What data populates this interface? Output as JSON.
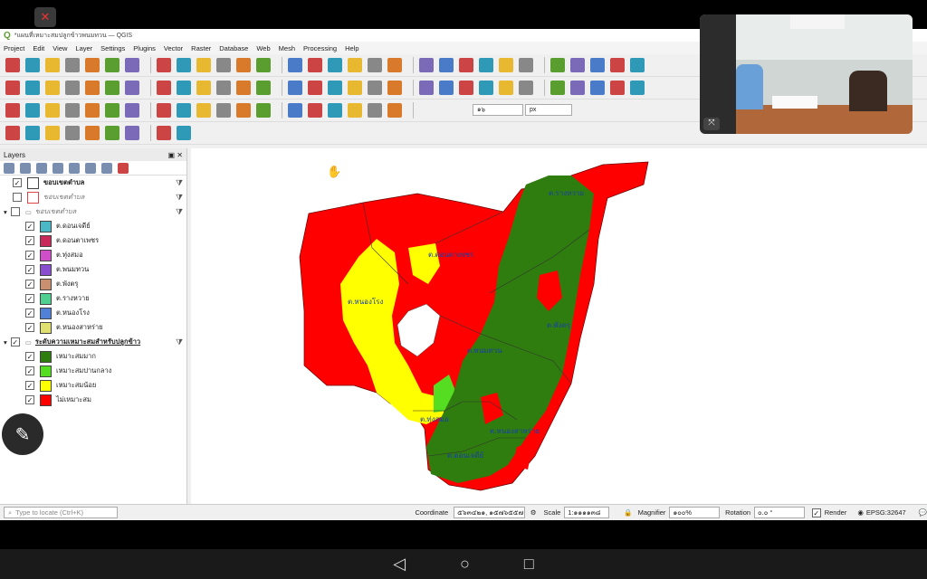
{
  "window": {
    "title": "*แผนที่เหมาะสมปลูกข้าวพนมทวน — QGIS"
  },
  "menu": [
    "Project",
    "Edit",
    "View",
    "Layer",
    "Settings",
    "Plugins",
    "Vector",
    "Raster",
    "Database",
    "Web",
    "Mesh",
    "Processing",
    "Help"
  ],
  "toolbar3": {
    "num_field": "๑๖",
    "unit_field": "px"
  },
  "layers_panel": {
    "title": "Layers",
    "items": [
      {
        "label": "ขอบเขตตำบล",
        "checked": true,
        "style": "bold",
        "swatch": "#ffffff"
      },
      {
        "label": "ขอบเขตตำบล",
        "checked": false,
        "style": "ital",
        "swatch": "#ffffff"
      },
      {
        "label": "ขอบเขตตำบล",
        "checked": false,
        "style": "ital",
        "group": true
      },
      {
        "label": "ต.ดอนเจดีย์",
        "checked": true,
        "swatch": "#4bb8c8"
      },
      {
        "label": "ต.ดอนตาเพชร",
        "checked": true,
        "swatch": "#c8285a"
      },
      {
        "label": "ต.ทุ่งสมอ",
        "checked": true,
        "swatch": "#d04fc8"
      },
      {
        "label": "ต.พนมทวน",
        "checked": true,
        "swatch": "#8a4fd0"
      },
      {
        "label": "ต.พังตรุ",
        "checked": true,
        "swatch": "#c89070"
      },
      {
        "label": "ต.รางหวาย",
        "checked": true,
        "swatch": "#4fd090"
      },
      {
        "label": "ต.หนองโรง",
        "checked": true,
        "swatch": "#5080d8"
      },
      {
        "label": "ต.หนองสาหร่าย",
        "checked": true,
        "swatch": "#e0e070"
      },
      {
        "label": "ระดับความเหมาะสมสำหรับปลูกข้าว",
        "checked": true,
        "style": "ul",
        "group": true
      },
      {
        "label": "เหมาะสมมาก",
        "checked": true,
        "swatch": "#2e7d0e"
      },
      {
        "label": "เหมาะสมปานกลาง",
        "checked": true,
        "swatch": "#55dd22"
      },
      {
        "label": "เหมาะสมน้อย",
        "checked": true,
        "swatch": "#ffff00"
      },
      {
        "label": "ไม่เหมาะสม",
        "checked": true,
        "swatch": "#ff0000"
      }
    ]
  },
  "map_labels": [
    {
      "text": "ต.รางหวาย",
      "id": "raang-waai"
    },
    {
      "text": "ต.ดอนตาเพชร",
      "id": "don-ta-phet"
    },
    {
      "text": "ต.หนองโรง",
      "id": "nong-rong"
    },
    {
      "text": "ต.พังตรุ",
      "id": "phang-tru"
    },
    {
      "text": "ต.พนมทวน",
      "id": "phanom-thuan"
    },
    {
      "text": "ต.ทุ่งสมอ",
      "id": "thung-samo"
    },
    {
      "text": "ต.หนองสาหร่าย",
      "id": "nong-sarai"
    },
    {
      "text": "ต.ดอนเจดีย์",
      "id": "don-chedi"
    }
  ],
  "status": {
    "locate_placeholder": "Type to locate (Ctrl+K)",
    "coordinate_label": "Coordinate",
    "coordinate_value": "๕๖๓๔๒๑, ๑๕๗๖๕๕๗",
    "scale_label": "Scale",
    "scale_value": "1:๑๑๑๑๓๘",
    "magnifier_label": "Magnifier",
    "magnifier_value": "๑๐๐%",
    "rotation_label": "Rotation",
    "rotation_value": "๐.๐ °",
    "render_label": "Render",
    "crs_label": "EPSG:32647"
  }
}
